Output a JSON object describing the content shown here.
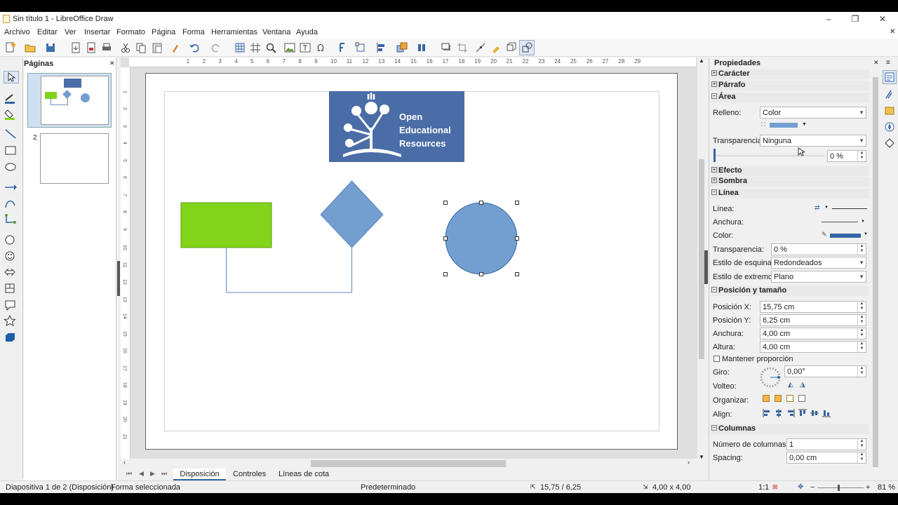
{
  "window": {
    "title": "Sin título 1 - LibreOffice Draw",
    "minimize": "–",
    "restore": "❐",
    "close": "✕",
    "doc_close": "✕"
  },
  "menu": [
    "Archivo",
    "Editar",
    "Ver",
    "Insertar",
    "Formato",
    "Página",
    "Forma",
    "Herramientas",
    "Ventana",
    "Ayuda"
  ],
  "pages_pane": {
    "title": "Páginas",
    "close": "✕",
    "page_numbers": [
      "1",
      "2"
    ]
  },
  "oer_logo": {
    "line1": "Open",
    "line2": "Educational",
    "line3": "Resources"
  },
  "ruler": {
    "h_labels": [
      "1",
      "2",
      "3",
      "4",
      "5",
      "6",
      "7",
      "8",
      "9",
      "10",
      "11",
      "12",
      "13",
      "14",
      "15",
      "16",
      "17",
      "18",
      "19",
      "20",
      "21",
      "22",
      "23",
      "24",
      "25",
      "26",
      "27",
      "28",
      "29"
    ],
    "v_labels": [
      "1",
      "2",
      "3",
      "4",
      "5",
      "6",
      "7",
      "8",
      "9",
      "10",
      "11",
      "12",
      "13",
      "14",
      "15",
      "16",
      "17",
      "18",
      "19",
      "20",
      "21"
    ]
  },
  "tabs": {
    "items": [
      "Disposición",
      "Controles",
      "Líneas de cota"
    ],
    "active": "Disposición"
  },
  "status": {
    "slide": "Diapositiva 1 de 2 (Disposición)",
    "selection": "Forma seleccionada",
    "master": "Predeterminado",
    "position": "15,75 / 6,25",
    "size": "4,00 x 4,00",
    "scale": "1:1",
    "zoom": "81 %"
  },
  "sidebar": {
    "title": "Propiedades",
    "sections": {
      "caracter": "Carácter",
      "parrafo": "Párrafo",
      "area": "Área",
      "efecto": "Efecto",
      "sombra": "Sombra",
      "linea": "Línea",
      "posicion": "Posición y tamaño",
      "columnas": "Columnas"
    },
    "area": {
      "relleno_label": "Relleno:",
      "relleno_value": "Color",
      "transparencia_label": "Transparencia:",
      "transparencia_value": "Ninguna",
      "transparency_pct": "0 %",
      "fill_color": "#729fcf"
    },
    "linea": {
      "linea_label": "Línea:",
      "anchura_label": "Anchura:",
      "color_label": "Color:",
      "line_color": "#3465a4",
      "transparencia_label": "Transparencia:",
      "transparencia_value": "0 %",
      "esquina_label": "Estilo de esquina:",
      "esquina_value": "Redondeados",
      "extremo_label": "Estilo de extremo:",
      "extremo_value": "Plano"
    },
    "posicion": {
      "x_label": "Posición X:",
      "x_value": "15,75 cm",
      "y_label": "Posición Y:",
      "y_value": "6,25 cm",
      "w_label": "Anchura:",
      "w_value": "4,00 cm",
      "h_label": "Altura:",
      "h_value": "4,00 cm",
      "keep_ratio": "Mantener proporción",
      "giro_label": "Giro:",
      "giro_value": "0,00°",
      "volteo_label": "Volteo:",
      "organizar_label": "Organizar:",
      "align_label": "Align:"
    },
    "columnas": {
      "num_label": "Número de columnas:",
      "num_value": "1",
      "spacing_label": "Spacing:",
      "spacing_value": "0,00 cm"
    }
  },
  "colors": {
    "green_rect": "#81d41a",
    "shape_blue": "#729fcf",
    "logo_bg": "#4a6da7",
    "accent": "#3465a4"
  }
}
